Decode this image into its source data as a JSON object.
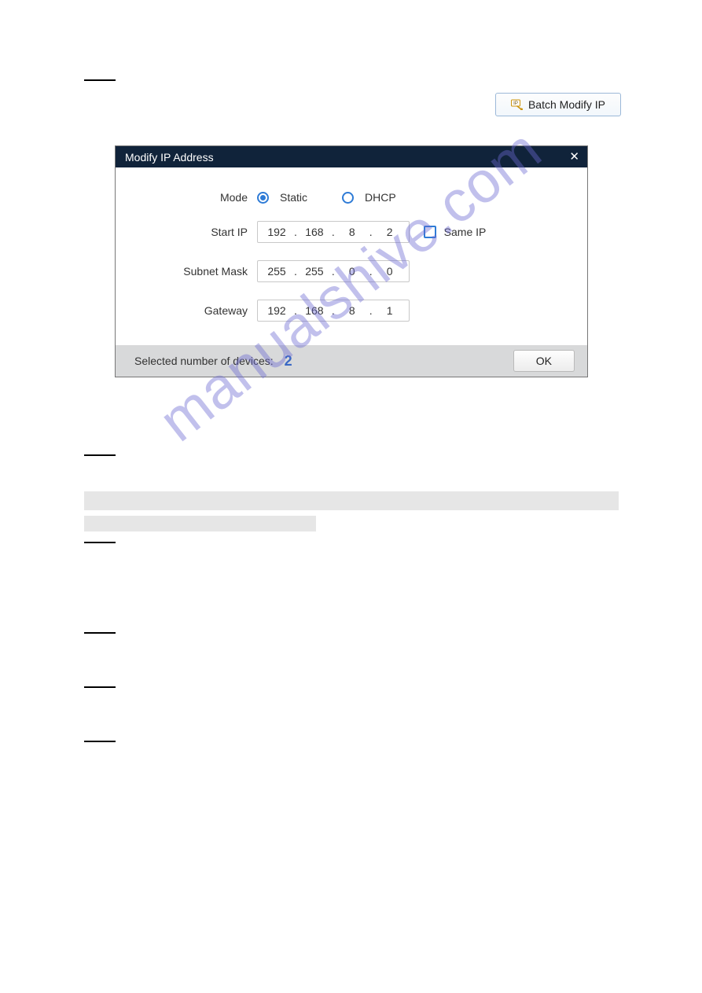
{
  "batch_modify_button": "Batch Modify IP",
  "dialog": {
    "title": "Modify IP Address",
    "mode_label": "Mode",
    "mode_static": "Static",
    "mode_dhcp": "DHCP",
    "start_ip_label": "Start IP",
    "start_ip": {
      "o1": "192",
      "o2": "168",
      "o3": "8",
      "o4": "2"
    },
    "same_ip_label": "Same IP",
    "subnet_label": "Subnet Mask",
    "subnet": {
      "o1": "255",
      "o2": "255",
      "o3": "0",
      "o4": "0"
    },
    "gateway_label": "Gateway",
    "gateway": {
      "o1": "192",
      "o2": "168",
      "o3": "8",
      "o4": "1"
    },
    "selected_label": "Selected number of devices:",
    "selected_count": "2",
    "ok_label": "OK"
  },
  "watermark_text": "manualshive.com"
}
